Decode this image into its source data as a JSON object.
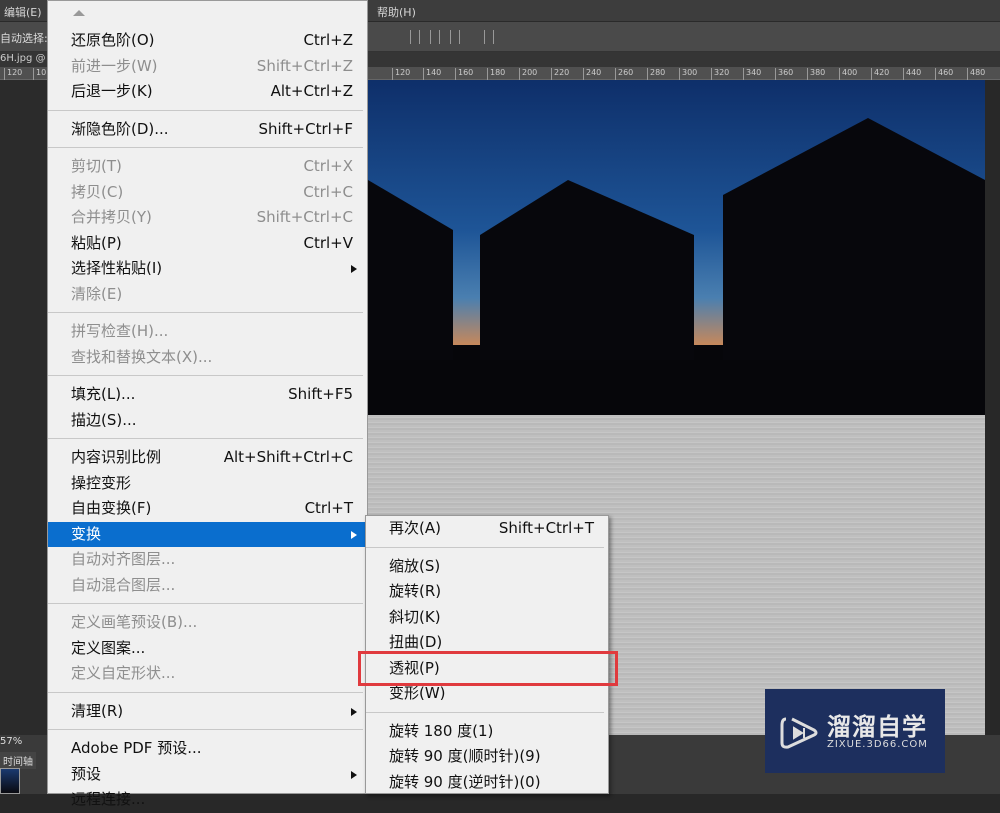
{
  "menubar": {
    "edit": "编辑(E)",
    "help": "帮助(H)"
  },
  "options": {
    "auto_select": "自动选择:"
  },
  "doc_tab": "6H.jpg @",
  "ruler": [
    "120",
    "10",
    "120",
    "140",
    "160",
    "180",
    "200",
    "220",
    "240",
    "260",
    "280",
    "300",
    "320",
    "340",
    "360",
    "380",
    "400",
    "420",
    "440",
    "460",
    "480"
  ],
  "status": {
    "zoom": "57%",
    "timeline": "时间轴"
  },
  "main_menu": [
    {
      "type": "up"
    },
    {
      "label": "还原色阶(O)",
      "sc": "Ctrl+Z"
    },
    {
      "label": "前进一步(W)",
      "sc": "Shift+Ctrl+Z",
      "dis": true
    },
    {
      "label": "后退一步(K)",
      "sc": "Alt+Ctrl+Z"
    },
    {
      "type": "sep"
    },
    {
      "label": "渐隐色阶(D)...",
      "sc": "Shift+Ctrl+F"
    },
    {
      "type": "sep"
    },
    {
      "label": "剪切(T)",
      "sc": "Ctrl+X",
      "dis": true
    },
    {
      "label": "拷贝(C)",
      "sc": "Ctrl+C",
      "dis": true
    },
    {
      "label": "合并拷贝(Y)",
      "sc": "Shift+Ctrl+C",
      "dis": true
    },
    {
      "label": "粘贴(P)",
      "sc": "Ctrl+V"
    },
    {
      "label": "选择性粘贴(I)",
      "sub": true
    },
    {
      "label": "清除(E)",
      "dis": true
    },
    {
      "type": "sep"
    },
    {
      "label": "拼写检查(H)...",
      "dis": true
    },
    {
      "label": "查找和替换文本(X)...",
      "dis": true
    },
    {
      "type": "sep"
    },
    {
      "label": "填充(L)...",
      "sc": "Shift+F5"
    },
    {
      "label": "描边(S)..."
    },
    {
      "type": "sep"
    },
    {
      "label": "内容识别比例",
      "sc": "Alt+Shift+Ctrl+C"
    },
    {
      "label": "操控变形"
    },
    {
      "label": "自由变换(F)",
      "sc": "Ctrl+T"
    },
    {
      "label": "变换",
      "sub": true,
      "hl": true
    },
    {
      "label": "自动对齐图层...",
      "dis": true
    },
    {
      "label": "自动混合图层...",
      "dis": true
    },
    {
      "type": "sep"
    },
    {
      "label": "定义画笔预设(B)...",
      "dis": true
    },
    {
      "label": "定义图案..."
    },
    {
      "label": "定义自定形状...",
      "dis": true
    },
    {
      "type": "sep"
    },
    {
      "label": "清理(R)",
      "sub": true
    },
    {
      "type": "sep"
    },
    {
      "label": "Adobe PDF 预设..."
    },
    {
      "label": "预设",
      "sub": true
    },
    {
      "label": "远程连接..."
    }
  ],
  "sub_menu": [
    {
      "label": "再次(A)",
      "sc": "Shift+Ctrl+T"
    },
    {
      "type": "sep"
    },
    {
      "label": "缩放(S)"
    },
    {
      "label": "旋转(R)"
    },
    {
      "label": "斜切(K)"
    },
    {
      "label": "扭曲(D)"
    },
    {
      "label": "透视(P)"
    },
    {
      "label": "变形(W)"
    },
    {
      "type": "sep"
    },
    {
      "label": "旋转 180 度(1)"
    },
    {
      "label": "旋转 90 度(顺时针)(9)"
    },
    {
      "label": "旋转 90 度(逆时针)(0)"
    }
  ],
  "watermark": {
    "name": "溜溜自学",
    "url": "ZIXUE.3D66.COM"
  }
}
